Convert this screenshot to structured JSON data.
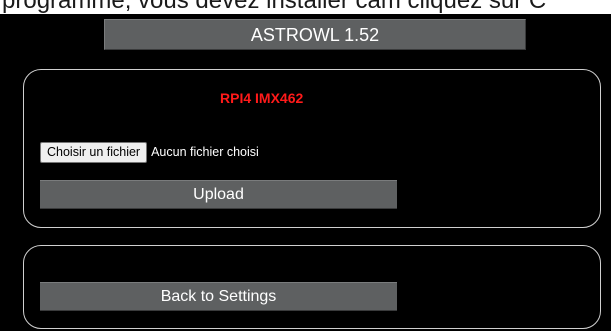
{
  "document_caption": {
    "text": "programme, vous devez installer cam  cliquez sur C"
  },
  "header": {
    "title": "ASTROWL 1.52"
  },
  "upload_panel": {
    "camera_label": "RPI4 IMX462",
    "file_input": {
      "button_label": "Choisir un fichier",
      "status_text": "Aucun fichier choisi"
    },
    "upload_label": "Upload"
  },
  "nav_panel": {
    "back_label": "Back to Settings"
  },
  "colors": {
    "background": "#000000",
    "button_gray": "#5e6061",
    "camera_label": "#ff1a1a",
    "panel_border": "#d0d0d0"
  }
}
